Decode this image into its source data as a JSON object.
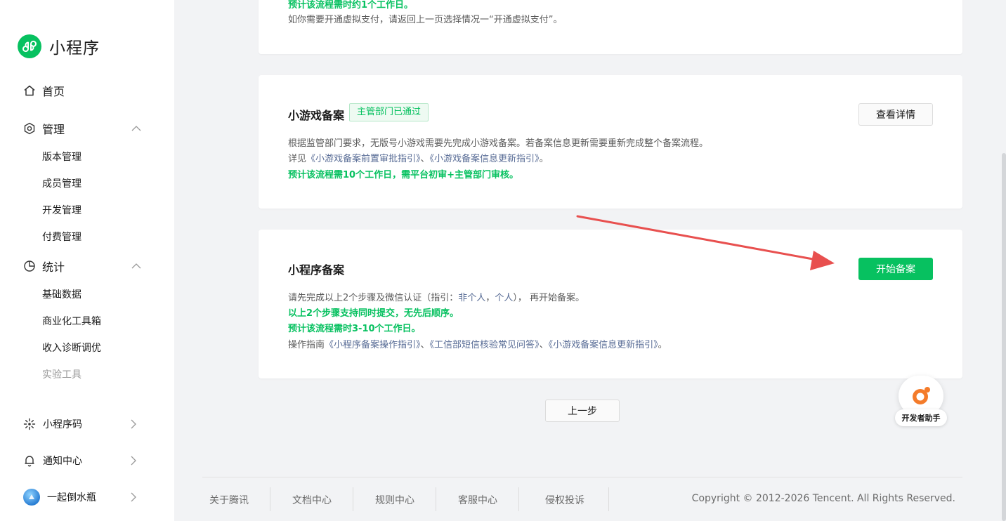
{
  "brand": {
    "title": "小程序"
  },
  "sidebar": {
    "home": "首页",
    "manage": {
      "label": "管理",
      "items": [
        "版本管理",
        "成员管理",
        "开发管理",
        "付费管理"
      ]
    },
    "stats": {
      "label": "统计",
      "items": [
        "基础数据",
        "商业化工具箱",
        "收入诊断调优",
        "实验工具"
      ]
    },
    "bottom": {
      "qrcode": "小程序码",
      "notify": "通知中心",
      "account": "一起倒水瓶"
    }
  },
  "top_card": {
    "partial_line": "预计该流程需时约1个工作日。",
    "line": "如你需要开通虚拟支付，请返回上一页选择情况一“开通虚拟支付”。"
  },
  "game_card": {
    "title": "小游戏备案",
    "tag": "主管部门已通过",
    "button": "查看详情",
    "line1": "根据监管部门要求，无版号小游戏需要先完成小游戏备案。若备案信息更新需要重新完成整个备案流程。",
    "line2_prefix": "详见",
    "link1": "《小游戏备案前置审批指引》",
    "sep1": "、",
    "link2": "《小游戏备案信息更新指引》",
    "line2_suffix": "。",
    "line3": "预计该流程需10个工作日，需平台初审+主管部门审核。"
  },
  "mp_card": {
    "title": "小程序备案",
    "button": "开始备案",
    "line1_prefix": "请先完成以上2个步骤及微信认证（指引：",
    "link_nonpersonal": "非个人",
    "comma": "，",
    "link_personal": "个人",
    "line1_suffix": "）， 再开始备案。",
    "line2": "以上2个步骤支持同时提交，无先后顺序。",
    "line3": "预计该流程需时3-10个工作日。",
    "line4_prefix": "操作指南",
    "link_a": "《小程序备案操作指引》",
    "sep_a": "、",
    "link_b": "《工信部短信核验常见问答》",
    "sep_b": "、",
    "link_c": "《小游戏备案信息更新指引》",
    "line4_suffix": "。"
  },
  "prev_button": "上一步",
  "helper": {
    "label": "开发者助手"
  },
  "footer": {
    "links": [
      "关于腾讯",
      "文档中心",
      "规则中心",
      "客服中心",
      "侵权投诉"
    ],
    "copyright": "Copyright © 2012-2026 Tencent. All Rights Reserved."
  },
  "colors": {
    "primary": "#07c160",
    "link": "#576b95",
    "annotation_arrow": "#e8504f"
  }
}
